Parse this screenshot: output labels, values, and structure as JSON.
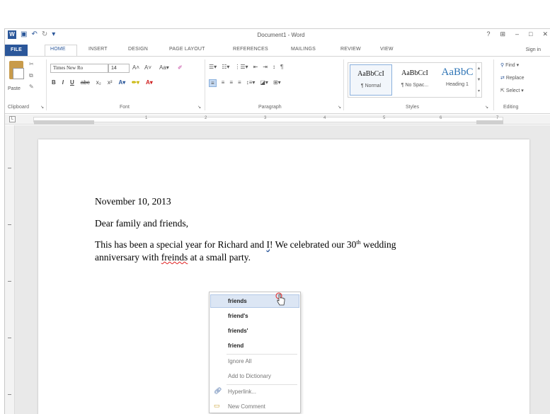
{
  "titlebar": {
    "doc_title": "Document1 - Word",
    "help": "?",
    "ribbon_opts": "⊞",
    "minimize": "–",
    "restore": "□",
    "close": "✕"
  },
  "tabs": {
    "file": "FILE",
    "home": "HOME",
    "insert": "INSERT",
    "design": "DESIGN",
    "page_layout": "PAGE LAYOUT",
    "references": "REFERENCES",
    "mailings": "MAILINGS",
    "review": "REVIEW",
    "view": "VIEW",
    "sign_in": "Sign in"
  },
  "ribbon": {
    "paste": "Paste",
    "clipboard": "Clipboard",
    "font_name": "Times New Ro",
    "font_size": "14",
    "font_group": "Font",
    "paragraph_group": "Paragraph",
    "styles_group": "Styles",
    "editing_group": "Editing",
    "styles": [
      {
        "sample": "AaBbCcI",
        "name": "¶ Normal"
      },
      {
        "sample": "AaBbCcI",
        "name": "¶ No Spac..."
      },
      {
        "sample": "AaBbC",
        "name": "Heading 1"
      }
    ],
    "find": "Find",
    "replace": "Replace",
    "select": "Select"
  },
  "ruler": {
    "numbers": [
      "1",
      "2",
      "3",
      "4",
      "5",
      "6",
      "7"
    ]
  },
  "document": {
    "date": "November 10, 2013",
    "greeting": "Dear family and friends,",
    "line1_a": "This has been a special year for Richard and ",
    "line1_i": "I",
    "line1_b": "! We celebrated our 30",
    "line1_sup": "th",
    "line1_c": " wedding",
    "line2_a": "anniversary with ",
    "line2_misspelled": "freinds",
    "line2_b": " at a small party."
  },
  "context_menu": {
    "suggestions": [
      "friends",
      "friend's",
      "friends'",
      "friend"
    ],
    "ignore_all": "Ignore All",
    "add_to_dictionary": "Add to Dictionary",
    "hyperlink": "Hyperlink...",
    "new_comment": "New Comment"
  },
  "colors": {
    "word_blue": "#2b579a",
    "highlight": "#dce6f4",
    "spell_error": "#e02020"
  }
}
